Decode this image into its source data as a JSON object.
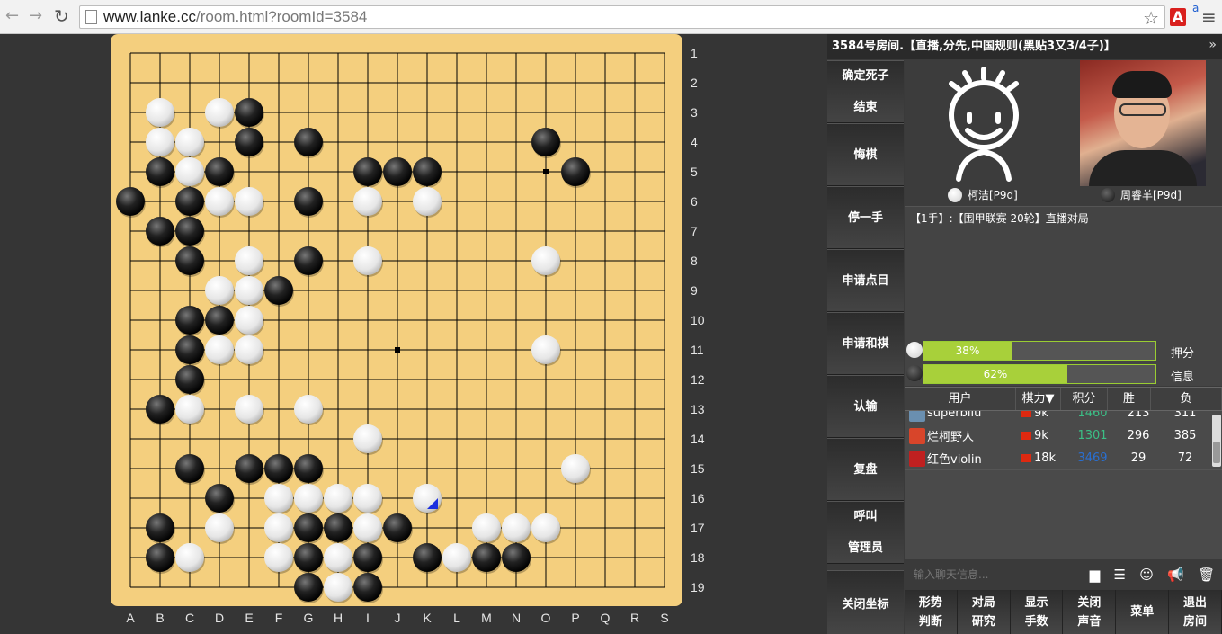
{
  "browser": {
    "url_host": "www.lanke.cc",
    "url_path": "/room.html?roomId=3584",
    "ext_translate": "a"
  },
  "board": {
    "size": 19,
    "columns": [
      "A",
      "B",
      "C",
      "D",
      "E",
      "F",
      "G",
      "H",
      "I",
      "J",
      "K",
      "L",
      "M",
      "N",
      "O",
      "P",
      "Q",
      "R",
      "S"
    ],
    "rows": [
      "1",
      "2",
      "3",
      "4",
      "5",
      "6",
      "7",
      "8",
      "9",
      "10",
      "11",
      "12",
      "13",
      "14",
      "15",
      "16",
      "17",
      "18",
      "19"
    ],
    "star_points": [
      [
        14,
        4
      ],
      [
        9,
        10
      ]
    ],
    "black_stones": [
      [
        4,
        2
      ],
      [
        4,
        3
      ],
      [
        6,
        3
      ],
      [
        14,
        3
      ],
      [
        1,
        4
      ],
      [
        3,
        4
      ],
      [
        8,
        4
      ],
      [
        9,
        4
      ],
      [
        10,
        4
      ],
      [
        15,
        4
      ],
      [
        0,
        5
      ],
      [
        2,
        5
      ],
      [
        6,
        5
      ],
      [
        1,
        6
      ],
      [
        2,
        6
      ],
      [
        2,
        7
      ],
      [
        6,
        7
      ],
      [
        5,
        8
      ],
      [
        2,
        9
      ],
      [
        3,
        9
      ],
      [
        2,
        10
      ],
      [
        2,
        11
      ],
      [
        1,
        12
      ],
      [
        2,
        14
      ],
      [
        4,
        14
      ],
      [
        5,
        14
      ],
      [
        6,
        14
      ],
      [
        3,
        15
      ],
      [
        1,
        16
      ],
      [
        6,
        16
      ],
      [
        7,
        16
      ],
      [
        9,
        16
      ],
      [
        1,
        17
      ],
      [
        6,
        17
      ],
      [
        8,
        17
      ],
      [
        10,
        17
      ],
      [
        12,
        17
      ],
      [
        13,
        17
      ],
      [
        6,
        18
      ],
      [
        8,
        18
      ]
    ],
    "white_stones": [
      [
        1,
        2
      ],
      [
        3,
        2
      ],
      [
        1,
        3
      ],
      [
        2,
        3
      ],
      [
        2,
        4
      ],
      [
        3,
        5
      ],
      [
        4,
        5
      ],
      [
        8,
        5
      ],
      [
        10,
        5
      ],
      [
        4,
        7
      ],
      [
        8,
        7
      ],
      [
        14,
        7
      ],
      [
        3,
        8
      ],
      [
        4,
        8
      ],
      [
        4,
        9
      ],
      [
        3,
        10
      ],
      [
        4,
        10
      ],
      [
        14,
        10
      ],
      [
        2,
        12
      ],
      [
        4,
        12
      ],
      [
        6,
        12
      ],
      [
        8,
        13
      ],
      [
        15,
        14
      ],
      [
        5,
        15
      ],
      [
        6,
        15
      ],
      [
        7,
        15
      ],
      [
        8,
        15
      ],
      [
        10,
        15
      ],
      [
        3,
        16
      ],
      [
        5,
        16
      ],
      [
        8,
        16
      ],
      [
        12,
        16
      ],
      [
        13,
        16
      ],
      [
        14,
        16
      ],
      [
        2,
        17
      ],
      [
        5,
        17
      ],
      [
        7,
        17
      ],
      [
        11,
        17
      ],
      [
        7,
        18
      ]
    ],
    "last_move": [
      10,
      15
    ],
    "last_move_color": "#1a2ee0"
  },
  "panel": {
    "room_title": "3584号房间.【直播,分先,中国规则(黑贴3又3/4子)】",
    "collapse_icon": "»",
    "side_buttons": [
      [
        "确定死子",
        "结束"
      ],
      [
        "悔棋"
      ],
      [
        "停一手"
      ],
      [
        "申请点目"
      ],
      [
        "申请和棋"
      ],
      [
        "认输"
      ],
      [
        "复盘"
      ],
      [
        "呼叫",
        "管理员"
      ]
    ],
    "coord_button": "关闭坐标",
    "white_player": "柯洁[P9d]",
    "black_player": "周睿羊[P9d]",
    "move_info": "【1手】:【围甲联赛 20轮】直播对局",
    "white_percent": "38%",
    "black_percent": "62%",
    "white_fraction": 0.38,
    "black_fraction": 0.62,
    "side_label_1": "押分",
    "side_label_2": "信息",
    "table_headers": [
      "用户",
      "棋力▼",
      "积分",
      "胜",
      "负"
    ],
    "users": [
      {
        "name": "superbilu",
        "rank": "9k",
        "score": "1460",
        "score_color": "#3bbf86",
        "win": "213",
        "lose": "311",
        "icon_color": "#6a8fb0"
      },
      {
        "name": "烂柯野人",
        "rank": "9k",
        "score": "1301",
        "score_color": "#3bbf86",
        "win": "296",
        "lose": "385",
        "icon_color": "#d8452a"
      },
      {
        "name": "红色violin",
        "rank": "18k",
        "score": "3469",
        "score_color": "#2a6fd0",
        "win": "29",
        "lose": "72",
        "icon_color": "#c02020"
      }
    ],
    "chat_placeholder": "输入聊天信息...",
    "chat_icons": [
      "▆",
      "☰",
      "☺",
      "📢",
      "🗑"
    ],
    "bottom_buttons": [
      [
        "形势",
        "判断"
      ],
      [
        "对局",
        "研究"
      ],
      [
        "显示",
        "手数"
      ],
      [
        "关闭",
        "声音"
      ],
      [
        "菜单"
      ],
      [
        "退出",
        "房间"
      ]
    ]
  }
}
